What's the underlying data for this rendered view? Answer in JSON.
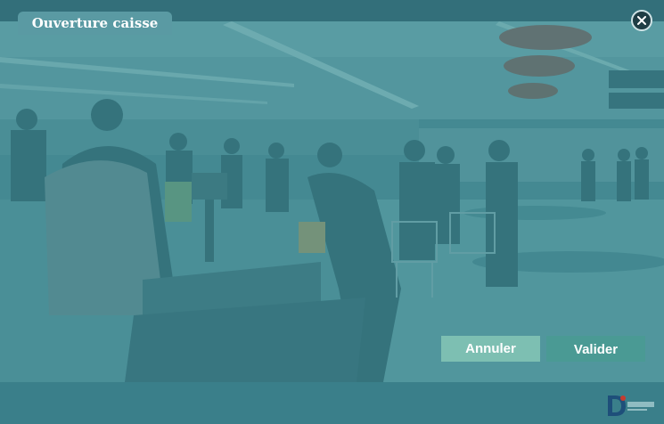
{
  "window": {
    "title": "Ouverture caisse"
  },
  "icons": {
    "close": "close-icon",
    "logo": "company-logo"
  },
  "actions": {
    "cancel_label": "Annuler",
    "validate_label": "Valider"
  },
  "colors": {
    "accent": "#3a7d88",
    "cancel_button": "#7dbfb2",
    "validate_button": "#4a9a94",
    "title_tab": "#5a9aa3"
  }
}
